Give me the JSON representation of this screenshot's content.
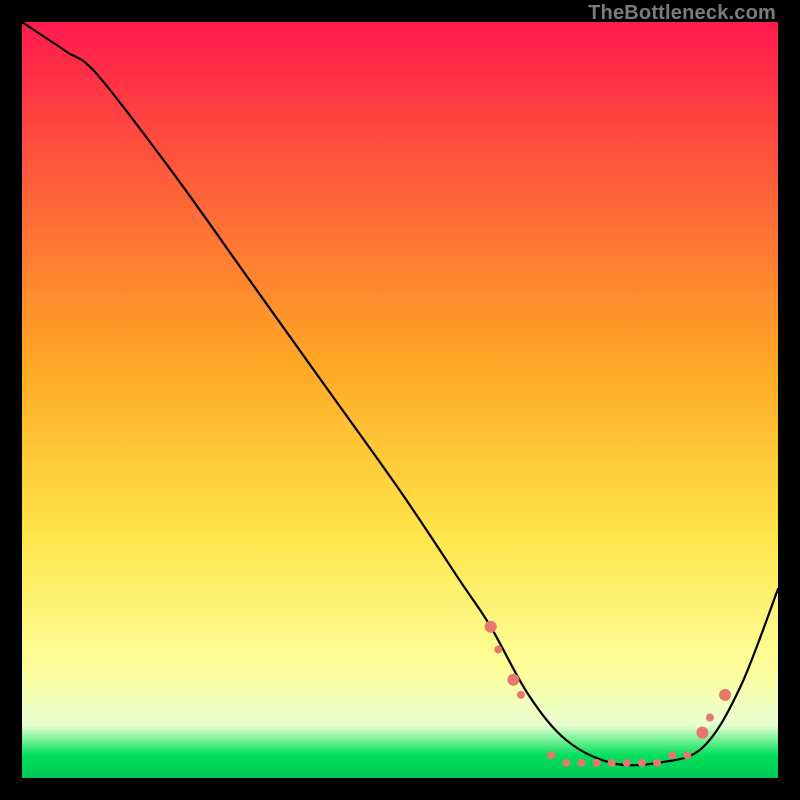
{
  "watermark": "TheBottleneck.com",
  "chart_data": {
    "type": "line",
    "title": "",
    "xlabel": "",
    "ylabel": "",
    "xlim": [
      0,
      100
    ],
    "ylim": [
      0,
      100
    ],
    "grid": false,
    "legend": false,
    "background": {
      "type": "vertical-gradient-with-green-band",
      "description": "Smooth vertical gradient from red at top through orange and yellow to pale yellow near bottom, with a narrow bright green band along the very bottom",
      "stops": [
        {
          "pos": 0,
          "color": "#ff1a4d"
        },
        {
          "pos": 20,
          "color": "#ff5a3a"
        },
        {
          "pos": 45,
          "color": "#ffa726"
        },
        {
          "pos": 68,
          "color": "#ffe64a"
        },
        {
          "pos": 86,
          "color": "#fdff9e"
        },
        {
          "pos": 93,
          "color": "#eaffd0"
        },
        {
          "pos": 97,
          "color": "#00e05c"
        },
        {
          "pos": 100,
          "color": "#00c851"
        }
      ]
    },
    "series": [
      {
        "name": "bottleneck-curve",
        "color": "#000000",
        "stroke_width": 2.2,
        "x": [
          0,
          3,
          6,
          10,
          20,
          30,
          40,
          50,
          58,
          62,
          67,
          72,
          78,
          84,
          90,
          95,
          100
        ],
        "y": [
          100,
          98,
          96,
          93,
          80,
          66,
          52,
          38,
          26,
          20,
          11,
          5,
          2,
          2,
          4,
          12,
          25
        ]
      }
    ],
    "markers": {
      "name": "optimal-range-dots",
      "color": "#e8776e",
      "radius_small": 4,
      "radius_large": 6,
      "points": [
        {
          "x": 62,
          "y": 20,
          "r": "large"
        },
        {
          "x": 63,
          "y": 17,
          "r": "small"
        },
        {
          "x": 65,
          "y": 13,
          "r": "large"
        },
        {
          "x": 66,
          "y": 11,
          "r": "small"
        },
        {
          "x": 70,
          "y": 3,
          "r": "small"
        },
        {
          "x": 72,
          "y": 2,
          "r": "small"
        },
        {
          "x": 74,
          "y": 2,
          "r": "small"
        },
        {
          "x": 76,
          "y": 2,
          "r": "small"
        },
        {
          "x": 78,
          "y": 2,
          "r": "small"
        },
        {
          "x": 80,
          "y": 2,
          "r": "small"
        },
        {
          "x": 82,
          "y": 2,
          "r": "small"
        },
        {
          "x": 84,
          "y": 2,
          "r": "small"
        },
        {
          "x": 86,
          "y": 3,
          "r": "small"
        },
        {
          "x": 88,
          "y": 3,
          "r": "small"
        },
        {
          "x": 90,
          "y": 6,
          "r": "large"
        },
        {
          "x": 91,
          "y": 8,
          "r": "small"
        },
        {
          "x": 93,
          "y": 11,
          "r": "large"
        }
      ]
    }
  }
}
